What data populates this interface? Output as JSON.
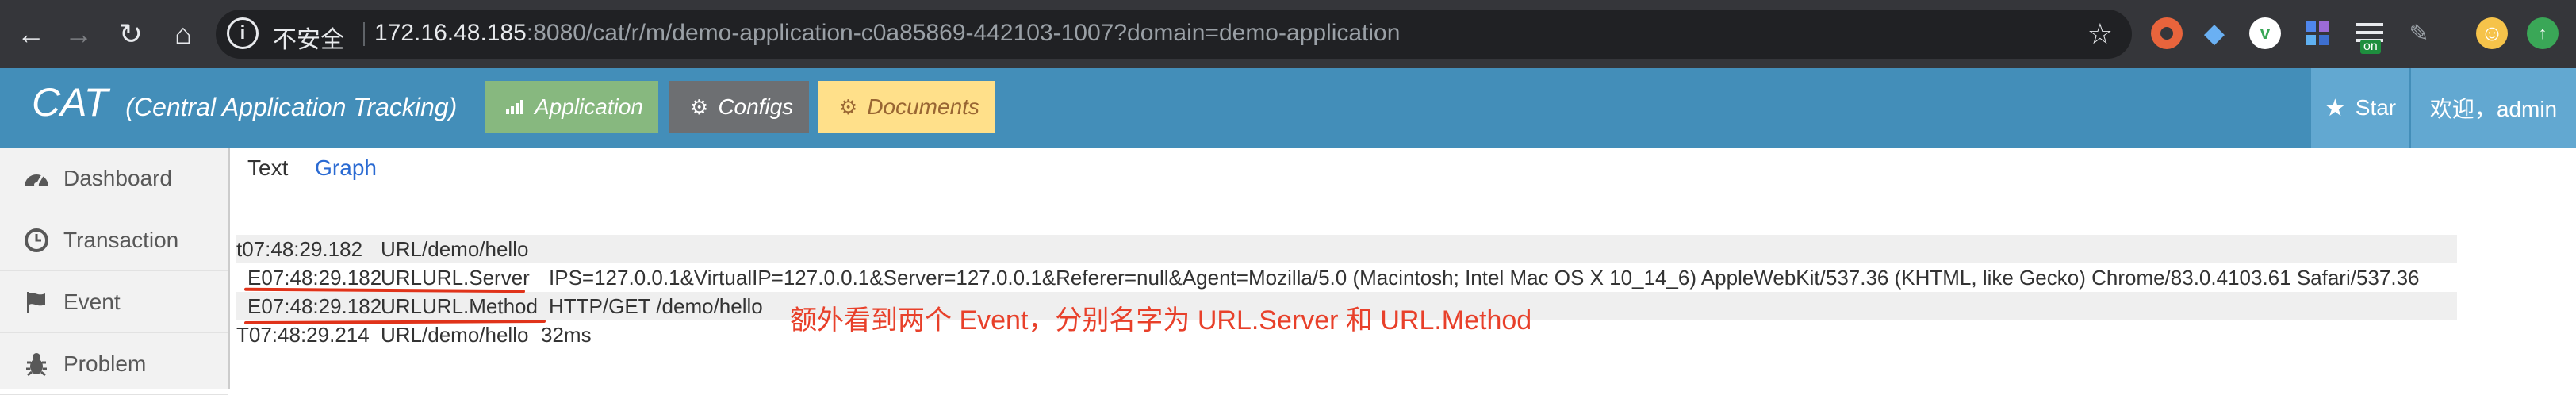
{
  "browser": {
    "nav_back": "←",
    "nav_forward": "→",
    "nav_reload": "↻",
    "nav_home": "⌂",
    "security_label": "不安全",
    "url_host": "172.16.48.185",
    "url_rest": ":8080/cat/r/m/demo-application-c0a85869-442103-1007?domain=demo-application",
    "extension_badge": "on",
    "icons": [
      "info-icon",
      "bookmark-star-icon",
      "extension-icons",
      "profile-avatar-icon"
    ]
  },
  "navbar": {
    "brand_title": "CAT",
    "brand_subtitle": "(Central Application Tracking)",
    "tabs": [
      {
        "label": "Application",
        "icon": "signal-icon"
      },
      {
        "label": "Configs",
        "icon": "cogs-icon"
      },
      {
        "label": "Documents",
        "icon": "cogs-icon"
      }
    ],
    "star_label": "Star",
    "user_label": "欢迎，admin",
    "colors": {
      "navbar": "#438eb9",
      "application": "#87b87f",
      "configs": "#6d6f72",
      "documents": "#ffe08a"
    }
  },
  "sidebar": {
    "items": [
      {
        "label": "Dashboard",
        "icon": "dashboard-icon"
      },
      {
        "label": "Transaction",
        "icon": "clock-icon"
      },
      {
        "label": "Event",
        "icon": "flag-icon"
      },
      {
        "label": "Problem",
        "icon": "bug-icon"
      }
    ]
  },
  "main": {
    "view_tabs": {
      "text": "Text",
      "graph": "Graph"
    },
    "log_rows": [
      {
        "cols": [
          "t07:48:29.182",
          "URL/demo/hello",
          ""
        ]
      },
      {
        "cols": [
          "E07:48:29.182",
          "URLURL.Server",
          "IPS=127.0.0.1&VirtualIP=127.0.0.1&Server=127.0.0.1&Referer=null&Agent=Mozilla/5.0 (Macintosh; Intel Mac OS X 10_14_6) AppleWebKit/537.36 (KHTML, like Gecko) Chrome/83.0.4103.61 Safari/537.36"
        ]
      },
      {
        "cols": [
          "E07:48:29.182",
          "URLURL.Method",
          "HTTP/GET /demo/hello"
        ]
      },
      {
        "cols": [
          "T07:48:29.214",
          "URL/demo/hello",
          "32ms"
        ]
      }
    ],
    "annotation": "额外看到两个 Event，分别名字为 URL.Server 和 URL.Method",
    "annotation_color": "#e8402a"
  }
}
